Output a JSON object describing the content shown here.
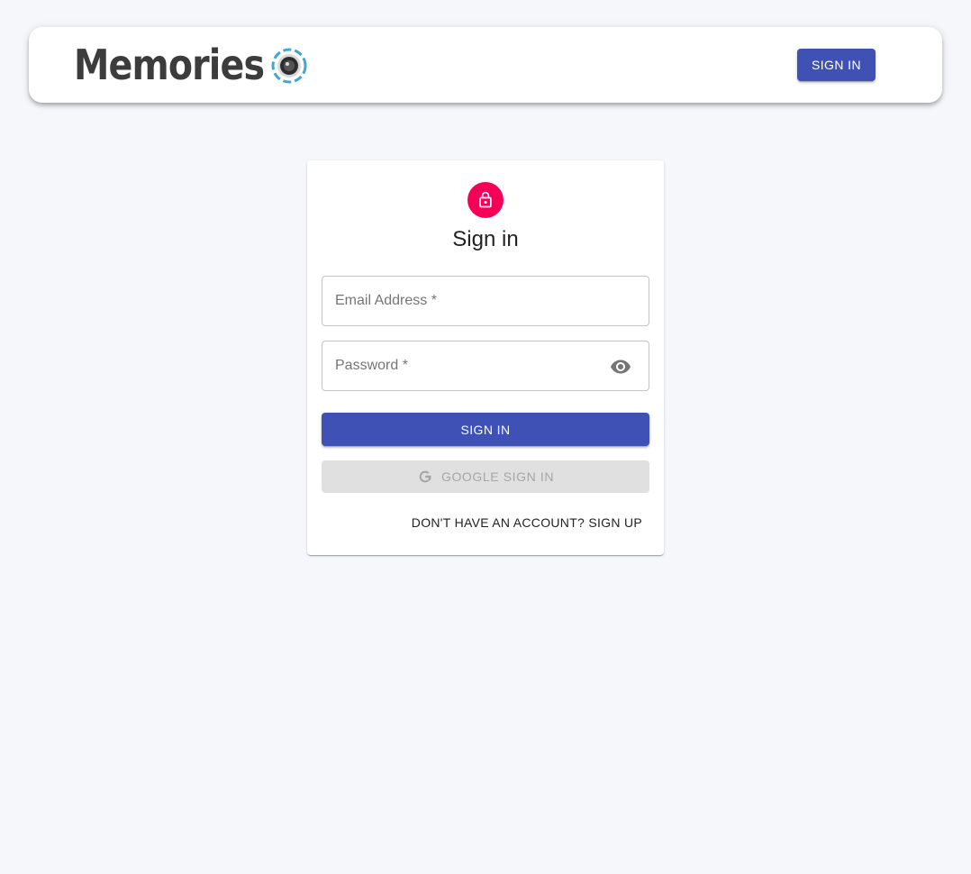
{
  "header": {
    "brand_text": "Memories",
    "signin_label": "SIGN IN"
  },
  "form": {
    "title": "Sign in",
    "email_placeholder": "Email Address *",
    "password_placeholder": "Password *",
    "submit_label": "SIGN IN",
    "google_label": "GOOGLE SIGN IN",
    "signup_link": "DON'T HAVE AN ACCOUNT? SIGN UP"
  },
  "icons": {
    "lock": "lock-icon",
    "eye": "visibility-icon",
    "google": "google-icon",
    "logo": "camera-lens-icon"
  },
  "colors": {
    "primary": "#3f51b5",
    "secondary": "#f50057",
    "background": "#f6f7fb",
    "disabled_bg": "#e0e0e0",
    "disabled_text": "#a6a6a6"
  }
}
